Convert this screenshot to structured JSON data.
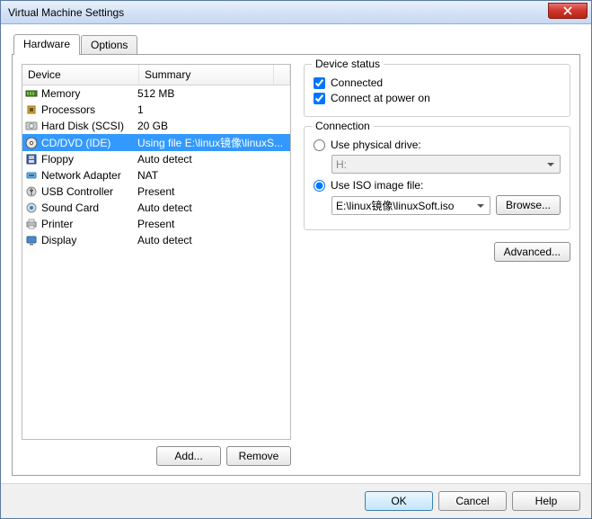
{
  "window": {
    "title": "Virtual Machine Settings"
  },
  "tabs": {
    "hardware": "Hardware",
    "options": "Options",
    "active": "hardware"
  },
  "list": {
    "headers": {
      "device": "Device",
      "summary": "Summary"
    },
    "rows": [
      {
        "name": "Memory",
        "summary": "512 MB"
      },
      {
        "name": "Processors",
        "summary": "1"
      },
      {
        "name": "Hard Disk (SCSI)",
        "summary": "20 GB"
      },
      {
        "name": "CD/DVD (IDE)",
        "summary": "Using file E:\\linux镜像\\linuxS...",
        "selected": true
      },
      {
        "name": "Floppy",
        "summary": "Auto detect"
      },
      {
        "name": "Network Adapter",
        "summary": "NAT"
      },
      {
        "name": "USB Controller",
        "summary": "Present"
      },
      {
        "name": "Sound Card",
        "summary": "Auto detect"
      },
      {
        "name": "Printer",
        "summary": "Present"
      },
      {
        "name": "Display",
        "summary": "Auto detect"
      }
    ],
    "buttons": {
      "add": "Add...",
      "remove": "Remove"
    }
  },
  "right": {
    "deviceStatus": {
      "title": "Device status",
      "connected": {
        "label": "Connected",
        "checked": true
      },
      "connectAtPowerOn": {
        "label": "Connect at power on",
        "checked": true
      }
    },
    "connection": {
      "title": "Connection",
      "physical": {
        "label": "Use physical drive:",
        "selected": false,
        "value": "H:"
      },
      "iso": {
        "label": "Use ISO image file:",
        "selected": true,
        "value": "E:\\linux镜像\\linuxSoft.iso",
        "browse": "Browse..."
      }
    },
    "advanced": "Advanced..."
  },
  "footer": {
    "ok": "OK",
    "cancel": "Cancel",
    "help": "Help"
  }
}
